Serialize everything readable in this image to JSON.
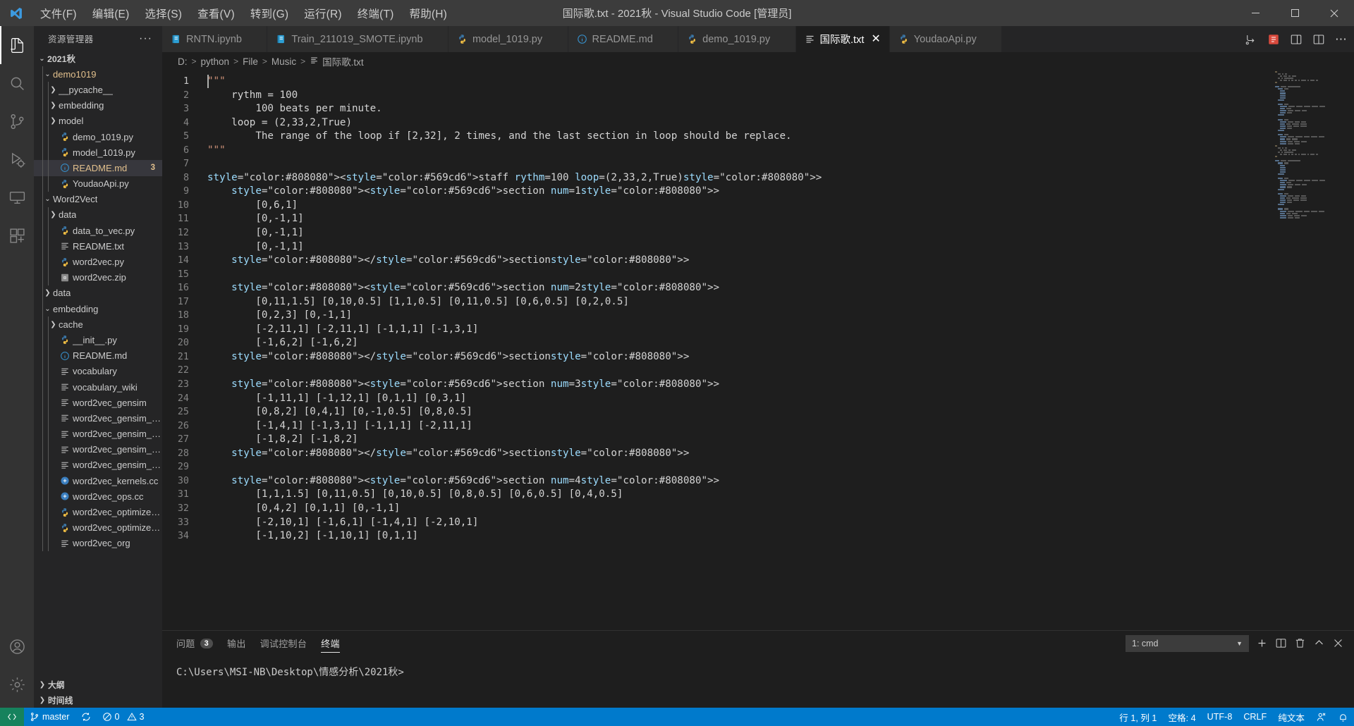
{
  "window": {
    "title": "国际歌.txt - 2021秋 - Visual Studio Code [管理员]",
    "minimize_label": "最小化",
    "maximize_label": "最大化",
    "close_label": "关闭"
  },
  "menubar": {
    "items": [
      {
        "label": "文件(F)",
        "name": "menu-file"
      },
      {
        "label": "编辑(E)",
        "name": "menu-edit"
      },
      {
        "label": "选择(S)",
        "name": "menu-selection"
      },
      {
        "label": "查看(V)",
        "name": "menu-view"
      },
      {
        "label": "转到(G)",
        "name": "menu-go"
      },
      {
        "label": "运行(R)",
        "name": "menu-run"
      },
      {
        "label": "终端(T)",
        "name": "menu-terminal"
      },
      {
        "label": "帮助(H)",
        "name": "menu-help"
      }
    ]
  },
  "activitybar": {
    "items": [
      {
        "name": "explorer",
        "icon": "files-icon",
        "active": true
      },
      {
        "name": "search",
        "icon": "search-icon",
        "active": false
      },
      {
        "name": "source-control",
        "icon": "source-control-icon",
        "active": false
      },
      {
        "name": "run-debug",
        "icon": "debug-icon",
        "active": false
      },
      {
        "name": "remote-explorer",
        "icon": "remote-icon",
        "active": false
      },
      {
        "name": "extensions",
        "icon": "extensions-icon",
        "active": false
      }
    ],
    "bottom": [
      {
        "name": "accounts",
        "icon": "account-icon"
      },
      {
        "name": "settings",
        "icon": "gear-icon"
      }
    ]
  },
  "sidebar": {
    "title": "资源管理器",
    "more_actions": "···",
    "tree": [
      {
        "label": "2021秋",
        "depth": 0,
        "type": "folder",
        "expanded": true,
        "root": true
      },
      {
        "label": "demo1019",
        "depth": 1,
        "type": "folder",
        "expanded": true,
        "gold": true
      },
      {
        "label": "__pycache__",
        "depth": 2,
        "type": "folder",
        "expanded": false
      },
      {
        "label": "embedding",
        "depth": 2,
        "type": "folder",
        "expanded": false
      },
      {
        "label": "model",
        "depth": 2,
        "type": "folder",
        "expanded": false
      },
      {
        "label": "demo_1019.py",
        "depth": 2,
        "type": "python"
      },
      {
        "label": "model_1019.py",
        "depth": 2,
        "type": "python"
      },
      {
        "label": "README.md",
        "depth": 2,
        "type": "markdown",
        "gold": true,
        "selected": true,
        "badge": "3"
      },
      {
        "label": "YoudaoApi.py",
        "depth": 2,
        "type": "python"
      },
      {
        "label": "Word2Vect",
        "depth": 1,
        "type": "folder",
        "expanded": true
      },
      {
        "label": "data",
        "depth": 2,
        "type": "folder",
        "expanded": false
      },
      {
        "label": "data_to_vec.py",
        "depth": 2,
        "type": "python"
      },
      {
        "label": "README.txt",
        "depth": 2,
        "type": "text"
      },
      {
        "label": "word2vec.py",
        "depth": 2,
        "type": "python"
      },
      {
        "label": "word2vec.zip",
        "depth": 2,
        "type": "zip"
      },
      {
        "label": "data",
        "depth": 1,
        "type": "folder",
        "expanded": false
      },
      {
        "label": "embedding",
        "depth": 1,
        "type": "folder",
        "expanded": true
      },
      {
        "label": "cache",
        "depth": 2,
        "type": "folder",
        "expanded": false
      },
      {
        "label": "__init__.py",
        "depth": 2,
        "type": "python"
      },
      {
        "label": "README.md",
        "depth": 2,
        "type": "markdown"
      },
      {
        "label": "vocabulary",
        "depth": 2,
        "type": "text"
      },
      {
        "label": "vocabulary_wiki",
        "depth": 2,
        "type": "text"
      },
      {
        "label": "word2vec_gensim",
        "depth": 2,
        "type": "text"
      },
      {
        "label": "word2vec_gensim_w...",
        "depth": 2,
        "type": "text"
      },
      {
        "label": "word2vec_gensim_w...",
        "depth": 2,
        "type": "text"
      },
      {
        "label": "word2vec_gensim_w...",
        "depth": 2,
        "type": "text"
      },
      {
        "label": "word2vec_gensim_w...",
        "depth": 2,
        "type": "text"
      },
      {
        "label": "word2vec_kernels.cc",
        "depth": 2,
        "type": "cpp"
      },
      {
        "label": "word2vec_ops.cc",
        "depth": 2,
        "type": "cpp"
      },
      {
        "label": "word2vec_optimized...",
        "depth": 2,
        "type": "python"
      },
      {
        "label": "word2vec_optimized...",
        "depth": 2,
        "type": "python"
      },
      {
        "label": "word2vec_org",
        "depth": 2,
        "type": "text"
      }
    ],
    "sections": [
      {
        "label": "大纲",
        "name": "outline-section"
      },
      {
        "label": "时间线",
        "name": "timeline-section"
      }
    ]
  },
  "tabs": [
    {
      "label": "RNTN.ipynb",
      "icon": "notebook-icon",
      "active": false
    },
    {
      "label": "Train_211019_SMOTE.ipynb",
      "icon": "notebook-icon",
      "active": false
    },
    {
      "label": "model_1019.py",
      "icon": "python-icon",
      "active": false
    },
    {
      "label": "README.md",
      "icon": "info-icon",
      "active": false
    },
    {
      "label": "demo_1019.py",
      "icon": "python-icon",
      "active": false
    },
    {
      "label": "国际歌.txt",
      "icon": "text-icon",
      "active": true
    },
    {
      "label": "YoudaoApi.py",
      "icon": "python-icon",
      "active": false
    }
  ],
  "tab_actions": [
    {
      "name": "run-or-preview-icon"
    },
    {
      "name": "extension-icon"
    },
    {
      "name": "open-changes-icon"
    },
    {
      "name": "split-editor-icon"
    },
    {
      "name": "more-actions-icon"
    }
  ],
  "breadcrumb": {
    "items": [
      "D:",
      "python",
      "File",
      "Music",
      "国际歌.txt"
    ],
    "separator": ">"
  },
  "editor": {
    "first_line": 1,
    "lines": [
      "\"\"\"",
      "    rythm = 100",
      "        100 beats per minute.",
      "    loop = (2,33,2,True)",
      "        The range of the loop if [2,32], 2 times, and the last section in loop should be replace.",
      "\"\"\"",
      "",
      "<staff rythm=100 loop=(2,33,2,True)>",
      "    <section num=1>",
      "        [0,6,1]",
      "        [0,-1,1]",
      "        [0,-1,1]",
      "        [0,-1,1]",
      "    </section>",
      "",
      "    <section num=2>",
      "        [0,11,1.5] [0,10,0.5] [1,1,0.5] [0,11,0.5] [0,6,0.5] [0,2,0.5]",
      "        [0,2,3] [0,-1,1]",
      "        [-2,11,1] [-2,11,1] [-1,1,1] [-1,3,1]",
      "        [-1,6,2] [-1,6,2]",
      "    </section>",
      "",
      "    <section num=3>",
      "        [-1,11,1] [-1,12,1] [0,1,1] [0,3,1]",
      "        [0,8,2] [0,4,1] [0,-1,0.5] [0,8,0.5]",
      "        [-1,4,1] [-1,3,1] [-1,1,1] [-2,11,1]",
      "        [-1,8,2] [-1,8,2]",
      "    </section>",
      "",
      "    <section num=4>",
      "        [1,1,1.5] [0,11,0.5] [0,10,0.5] [0,8,0.5] [0,6,0.5] [0,4,0.5]",
      "        [0,4,2] [0,1,1] [0,-1,1]",
      "        [-2,10,1] [-1,6,1] [-1,4,1] [-2,10,1]",
      "        [-1,10,2] [-1,10,1] [0,1,1]"
    ]
  },
  "panel": {
    "tabs": [
      {
        "label": "问题",
        "badge": "3",
        "active": false,
        "name": "panel-tab-problems"
      },
      {
        "label": "输出",
        "badge": "",
        "active": false,
        "name": "panel-tab-output"
      },
      {
        "label": "调试控制台",
        "badge": "",
        "active": false,
        "name": "panel-tab-debug-console"
      },
      {
        "label": "终端",
        "badge": "",
        "active": true,
        "name": "panel-tab-terminal"
      }
    ],
    "terminal_select": "1: cmd",
    "actions": [
      {
        "name": "new-terminal-icon",
        "label": "+"
      },
      {
        "name": "split-terminal-icon"
      },
      {
        "name": "kill-terminal-icon"
      },
      {
        "name": "maximize-panel-icon"
      },
      {
        "name": "close-panel-icon"
      }
    ],
    "terminal_text": "C:\\Users\\MSI-NB\\Desktop\\情感分析\\2021秋>"
  },
  "statusbar": {
    "remote_label": "",
    "branch": "master",
    "sync_label": "",
    "errors": "0",
    "warnings": "3",
    "cursor_position": "行 1, 列 1",
    "indentation": "空格: 4",
    "encoding": "UTF-8",
    "eol": "CRLF",
    "language": "纯文本",
    "feedback": "feedback-icon",
    "notifications": "bell-icon"
  },
  "colors": {
    "accent": "#007acc",
    "titlebar_bg": "#3c3c3c",
    "sidebar_bg": "#252526",
    "editor_bg": "#1e1e1e",
    "activitybar_bg": "#333333",
    "gold": "#e2c08d",
    "remote_green": "#16825d"
  }
}
